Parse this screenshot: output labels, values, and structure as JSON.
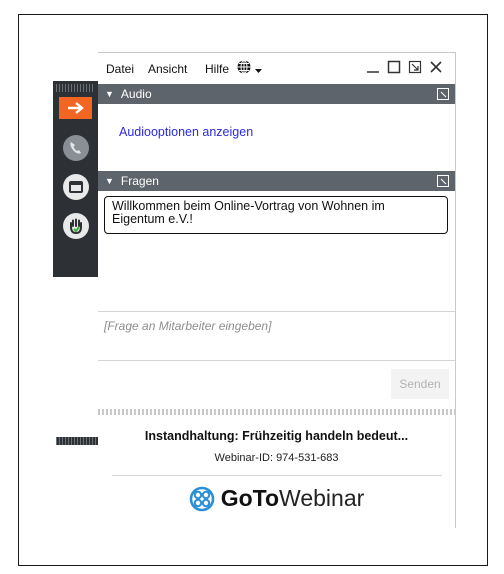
{
  "menu": {
    "items": [
      "Datei",
      "Ansicht",
      "Hilfe"
    ]
  },
  "window_controls": [
    "minimize",
    "maximize",
    "popout",
    "close"
  ],
  "audio": {
    "header": "Audio",
    "link": "Audiooptionen anzeigen"
  },
  "questions": {
    "header": "Fragen",
    "message": "Willkommen beim Online-Vortrag von Wohnen im Eigentum e.V.!",
    "input_placeholder": "[Frage an Mitarbeiter eingeben]",
    "send_label": "Senden"
  },
  "footer": {
    "webinar_title": "Instandhaltung: Frühzeitig handeln bedeut...",
    "webinar_id": "Webinar-ID: 974-531-683",
    "brand_goto": "GoTo",
    "brand_webinar": "Webinar"
  },
  "colors": {
    "accent_orange": "#f26522",
    "section_header": "#5e646b",
    "link_blue": "#2a2ae0",
    "strip_bg": "#2d3136",
    "brand_blue": "#2b8fd6"
  },
  "icons": [
    "arrow-right-icon",
    "phone-icon",
    "window-icon",
    "hand-icon",
    "globe-icon",
    "goto-logo-icon"
  ]
}
